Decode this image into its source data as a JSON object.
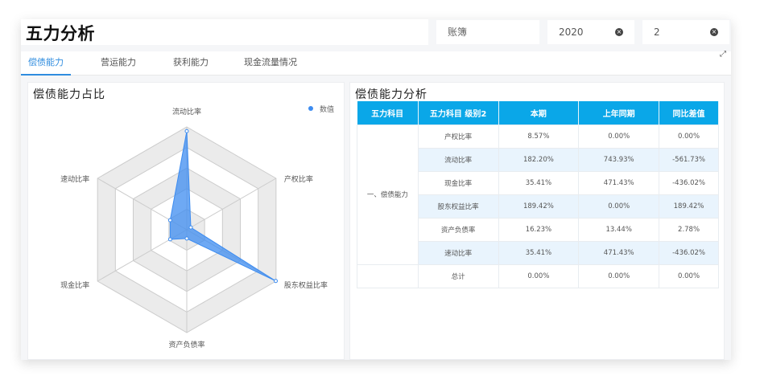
{
  "header": {
    "title": "五力分析",
    "ledger_placeholder": "账簿",
    "year": "2020",
    "period": "2"
  },
  "tabs": [
    {
      "label": "偿债能力",
      "active": true
    },
    {
      "label": "营运能力",
      "active": false
    },
    {
      "label": "获利能力",
      "active": false
    },
    {
      "label": "现金流量情况",
      "active": false
    }
  ],
  "left_panel": {
    "title": "偿债能力占比",
    "legend": "数值"
  },
  "right_panel": {
    "title": "偿债能力分析"
  },
  "chart_data": {
    "type": "radar",
    "indicators": [
      "流动比率",
      "产权比率",
      "股东权益比率",
      "资产负债率",
      "现金比率",
      "速动比率"
    ],
    "series": [
      {
        "name": "数值",
        "values": [
          182.2,
          8.57,
          189.42,
          16.23,
          35.41,
          35.41
        ]
      }
    ],
    "max": 190,
    "rings": 5,
    "series_color": "#3d8cf0",
    "ring_colors": [
      "#ffffff",
      "#ebebeb"
    ]
  },
  "table": {
    "headers": [
      "五力科目",
      "五力科目 级别2",
      "本期",
      "上年同期",
      "同比差值"
    ],
    "group_label": "一、偿债能力",
    "rows": [
      {
        "name": "产权比率",
        "current": "8.57%",
        "previous": "0.00%",
        "diff": "0.00%"
      },
      {
        "name": "流动比率",
        "current": "182.20%",
        "previous": "743.93%",
        "diff": "-561.73%"
      },
      {
        "name": "现金比率",
        "current": "35.41%",
        "previous": "471.43%",
        "diff": "-436.02%"
      },
      {
        "name": "股东权益比率",
        "current": "189.42%",
        "previous": "0.00%",
        "diff": "189.42%"
      },
      {
        "name": "资产负债率",
        "current": "16.23%",
        "previous": "13.44%",
        "diff": "2.78%"
      },
      {
        "name": "速动比率",
        "current": "35.41%",
        "previous": "471.43%",
        "diff": "-436.02%"
      },
      {
        "name": "总计",
        "current": "0.00%",
        "previous": "0.00%",
        "diff": "0.00%"
      }
    ]
  }
}
